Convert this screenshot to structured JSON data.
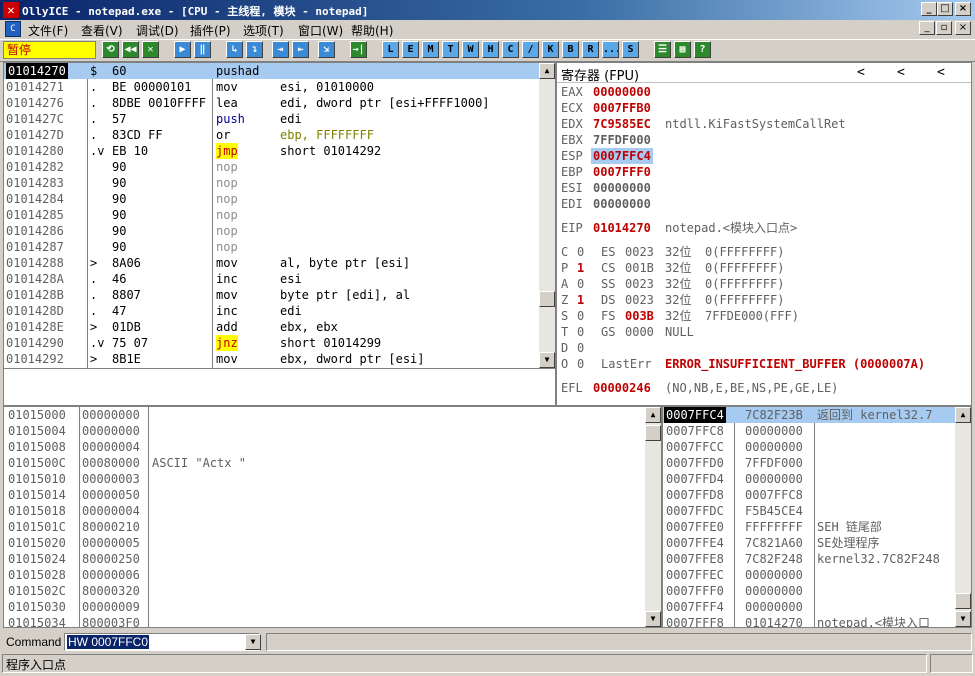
{
  "window": {
    "title": "OllyICE - notepad.exe - [CPU - 主线程, 模块 - notepad]",
    "app_icon": "OllyICE-bug-icon",
    "controls": [
      "_",
      "□",
      "×"
    ],
    "mdi_controls": [
      "_",
      "▫",
      "×"
    ]
  },
  "menu": [
    {
      "label": "文件(F)"
    },
    {
      "label": "查看(V)"
    },
    {
      "label": "调试(D)"
    },
    {
      "label": "插件(P)"
    },
    {
      "label": "选项(T)"
    },
    {
      "label": "窗口(W)"
    },
    {
      "label": "帮助(H)"
    }
  ],
  "toolbar": {
    "status": "暂停",
    "buttons": [
      "⟲",
      "◀◀",
      "✕",
      "▶",
      "‖",
      "↳",
      "↴",
      "⇥",
      "⇤",
      "⇲",
      "→|",
      "L",
      "E",
      "M",
      "T",
      "W",
      "H",
      "C",
      "/",
      "K",
      "B",
      "R",
      "...",
      "S",
      "☰",
      "▦",
      "?"
    ]
  },
  "disasm": [
    {
      "addr": "01014270",
      "mark": "$",
      "hex": "60",
      "mn": "pushad",
      "ops": "",
      "sel": true
    },
    {
      "addr": "01014271",
      "mark": ".",
      "hex": "BE 00000101",
      "mn": "mov",
      "ops": "esi, 01010000"
    },
    {
      "addr": "01014276",
      "mark": ".",
      "hex": "8DBE 0010FFFF",
      "mn": "lea",
      "ops": "edi, dword ptr [esi+FFFF1000]"
    },
    {
      "addr": "0101427C",
      "mark": ".",
      "hex": "57",
      "mn": "push",
      "ops": "edi"
    },
    {
      "addr": "0101427D",
      "mark": ".",
      "hex": "83CD FF",
      "mn": "or",
      "ops": "ebp, FFFFFFFF"
    },
    {
      "addr": "01014280",
      "mark": ".v",
      "hex": "EB 10",
      "mn": "jmp",
      "ops": "short 01014292"
    },
    {
      "addr": "01014282",
      "mark": "",
      "hex": "90",
      "mn": "nop",
      "ops": ""
    },
    {
      "addr": "01014283",
      "mark": "",
      "hex": "90",
      "mn": "nop",
      "ops": ""
    },
    {
      "addr": "01014284",
      "mark": "",
      "hex": "90",
      "mn": "nop",
      "ops": ""
    },
    {
      "addr": "01014285",
      "mark": "",
      "hex": "90",
      "mn": "nop",
      "ops": ""
    },
    {
      "addr": "01014286",
      "mark": "",
      "hex": "90",
      "mn": "nop",
      "ops": ""
    },
    {
      "addr": "01014287",
      "mark": "",
      "hex": "90",
      "mn": "nop",
      "ops": ""
    },
    {
      "addr": "01014288",
      "mark": ">",
      "hex": "8A06",
      "mn": "mov",
      "ops": "al, byte ptr [esi]"
    },
    {
      "addr": "0101428A",
      "mark": ".",
      "hex": "46",
      "mn": "inc",
      "ops": "esi"
    },
    {
      "addr": "0101428B",
      "mark": ".",
      "hex": "8807",
      "mn": "mov",
      "ops": "byte ptr [edi], al"
    },
    {
      "addr": "0101428D",
      "mark": ".",
      "hex": "47",
      "mn": "inc",
      "ops": "edi"
    },
    {
      "addr": "0101428E",
      "mark": ">",
      "hex": "01DB",
      "mn": "add",
      "ops": "ebx, ebx"
    },
    {
      "addr": "01014290",
      "mark": ".v",
      "hex": "75 07",
      "mn": "jnz",
      "ops": "short 01014299"
    },
    {
      "addr": "01014292",
      "mark": ">",
      "hex": "8B1E",
      "mn": "mov",
      "ops": "ebx, dword ptr [esi]"
    }
  ],
  "registers": {
    "header": "寄存器 (FPU)",
    "nav": [
      "<",
      "<",
      "<"
    ],
    "gp": [
      {
        "name": "EAX",
        "val": "00000000",
        "changed": true,
        "note": ""
      },
      {
        "name": "ECX",
        "val": "0007FFB0",
        "changed": true,
        "note": ""
      },
      {
        "name": "EDX",
        "val": "7C9585EC",
        "changed": true,
        "note": "ntdll.KiFastSystemCallRet"
      },
      {
        "name": "EBX",
        "val": "7FFDF000",
        "changed": false,
        "note": ""
      },
      {
        "name": "ESP",
        "val": "0007FFC4",
        "changed": true,
        "note": "",
        "hl": true
      },
      {
        "name": "EBP",
        "val": "0007FFF0",
        "changed": true,
        "note": ""
      },
      {
        "name": "ESI",
        "val": "00000000",
        "changed": false,
        "note": ""
      },
      {
        "name": "EDI",
        "val": "00000000",
        "changed": false,
        "note": ""
      }
    ],
    "eip": {
      "name": "EIP",
      "val": "01014270",
      "note": "notepad.<模块入口点>"
    },
    "flags": [
      {
        "f": "C",
        "v": "0",
        "seg": "ES",
        "sel": "0023",
        "bits": "32位",
        "base": "0(FFFFFFFF)",
        "vred": false,
        "selred": false
      },
      {
        "f": "P",
        "v": "1",
        "seg": "CS",
        "sel": "001B",
        "bits": "32位",
        "base": "0(FFFFFFFF)",
        "vred": true,
        "selred": false
      },
      {
        "f": "A",
        "v": "0",
        "seg": "SS",
        "sel": "0023",
        "bits": "32位",
        "base": "0(FFFFFFFF)",
        "vred": false,
        "selred": false
      },
      {
        "f": "Z",
        "v": "1",
        "seg": "DS",
        "sel": "0023",
        "bits": "32位",
        "base": "0(FFFFFFFF)",
        "vred": true,
        "selred": false
      },
      {
        "f": "S",
        "v": "0",
        "seg": "FS",
        "sel": "003B",
        "bits": "32位",
        "base": "7FFDE000(FFF)",
        "vred": false,
        "selred": true
      },
      {
        "f": "T",
        "v": "0",
        "seg": "GS",
        "sel": "0000",
        "bits": "NULL",
        "base": "",
        "vred": false,
        "selred": false
      },
      {
        "f": "D",
        "v": "0",
        "seg": "",
        "sel": "",
        "bits": "",
        "base": "",
        "vred": false,
        "selred": false
      }
    ],
    "lasterr": {
      "f": "O",
      "v": "0",
      "label": "LastErr",
      "val": "ERROR_INSUFFICIENT_BUFFER (0000007A)"
    },
    "efl": {
      "label": "EFL",
      "val": "00000246",
      "note": "(NO,NB,E,BE,NS,PE,GE,LE)"
    }
  },
  "dump": [
    {
      "addr": "01015000",
      "val": "00000000",
      "ascii": ""
    },
    {
      "addr": "01015004",
      "val": "00000000",
      "ascii": ""
    },
    {
      "addr": "01015008",
      "val": "00000004",
      "ascii": ""
    },
    {
      "addr": "0101500C",
      "val": "00080000",
      "ascii": "ASCII \"Actx \""
    },
    {
      "addr": "01015010",
      "val": "00000003",
      "ascii": ""
    },
    {
      "addr": "01015014",
      "val": "00000050",
      "ascii": ""
    },
    {
      "addr": "01015018",
      "val": "00000004",
      "ascii": ""
    },
    {
      "addr": "0101501C",
      "val": "80000210",
      "ascii": ""
    },
    {
      "addr": "01015020",
      "val": "00000005",
      "ascii": ""
    },
    {
      "addr": "01015024",
      "val": "80000250",
      "ascii": ""
    },
    {
      "addr": "01015028",
      "val": "00000006",
      "ascii": ""
    },
    {
      "addr": "0101502C",
      "val": "80000320",
      "ascii": ""
    },
    {
      "addr": "01015030",
      "val": "00000009",
      "ascii": ""
    },
    {
      "addr": "01015034",
      "val": "800003F0",
      "ascii": ""
    }
  ],
  "stack": [
    {
      "addr": "0007FFC4",
      "val": "7C82F23B",
      "note": "返回到 kernel32.7",
      "sel": true
    },
    {
      "addr": "0007FFC8",
      "val": "00000000",
      "note": ""
    },
    {
      "addr": "0007FFCC",
      "val": "00000000",
      "note": ""
    },
    {
      "addr": "0007FFD0",
      "val": "7FFDF000",
      "note": ""
    },
    {
      "addr": "0007FFD4",
      "val": "00000000",
      "note": ""
    },
    {
      "addr": "0007FFD8",
      "val": "0007FFC8",
      "note": ""
    },
    {
      "addr": "0007FFDC",
      "val": "F5B45CE4",
      "note": ""
    },
    {
      "addr": "0007FFE0",
      "val": "FFFFFFFF",
      "note": "SEH 链尾部"
    },
    {
      "addr": "0007FFE4",
      "val": "7C821A60",
      "note": "SE处理程序"
    },
    {
      "addr": "0007FFE8",
      "val": "7C82F248",
      "note": "kernel32.7C82F248"
    },
    {
      "addr": "0007FFEC",
      "val": "00000000",
      "note": ""
    },
    {
      "addr": "0007FFF0",
      "val": "00000000",
      "note": ""
    },
    {
      "addr": "0007FFF4",
      "val": "00000000",
      "note": ""
    },
    {
      "addr": "0007FFF8",
      "val": "01014270",
      "note": "notepad.<模块入口"
    }
  ],
  "command": {
    "label": "Command",
    "value": "HW 0007FFC0"
  },
  "status": {
    "text": "程序入口点"
  }
}
